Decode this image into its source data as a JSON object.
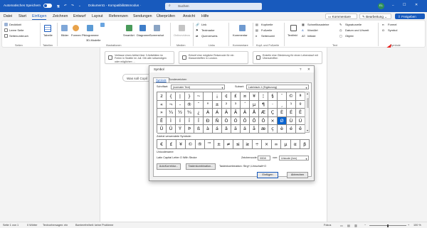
{
  "titlebar": {
    "autosave": "Automatisches Speichern",
    "autosave_state": "",
    "doc_title": "Dokument1  -  Kompatibilitätsmodus  ·",
    "search": "Suchen",
    "avatar": "EL",
    "min": "–",
    "max": "☐",
    "close": "✕"
  },
  "menu": {
    "tabs": [
      "Datei",
      "Start",
      "Einfügen",
      "Zeichnen",
      "Entwurf",
      "Layout",
      "Referenzen",
      "Sendungen",
      "Überprüfen",
      "Ansicht",
      "Hilfe"
    ],
    "comments": "Kommentare",
    "editing": "Bearbeitung",
    "share": "Freigeben"
  },
  "ribbon": {
    "pages": [
      "Deckblatt",
      "Leere Seite",
      "Seitenumbruch"
    ],
    "pages_group": "Seiten",
    "table": "Tabelle",
    "table_group": "Tabellen",
    "illus": [
      "Bilder",
      "Formen",
      "Piktogramme",
      "3D-Modelle",
      "SmartArt",
      "Diagramm",
      "Screenshot"
    ],
    "illus_group": "Illustrationen",
    "media": "Onlinevideos",
    "media_group": "Medien",
    "links": [
      "Link",
      "Textmarke",
      "Querverweis"
    ],
    "links_group": "Links",
    "comment": "Kommentar",
    "comment_group": "Kommentare",
    "header": [
      "Kopfzeile",
      "Fußzeile",
      "Seitenzahl"
    ],
    "header_group": "Kopf- und Fußzeile",
    "textbox": "Textfeld",
    "text_items": [
      "Schnellbausteine",
      "WordArt",
      "Initiale"
    ],
    "text_items2": [
      "Signaturzeile",
      "Datum und Uhrzeit",
      "Objekt"
    ],
    "text_group": "Text",
    "formula": "Formel",
    "symbol": "Symbol",
    "symbols_group": "Symbole"
  },
  "cards": [
    "Verfasse einen Artikel über 3 Aktivitäten im Freien in Seattle im Juli. Gib alle notwendigen oder möglichen …",
    "Entwirf eine mögliche Reiseroute für ein Klassentreffen in London.",
    "Erstelle eine Gliederung für einen Lebenslauf mit Überschriften"
  ],
  "askbar": "Was soll Copil",
  "dialog": {
    "title": "Symbol",
    "help": "?",
    "close": "✕",
    "tab_symbols": "Symbole",
    "tab_special": "Sonderzeichen",
    "font_label": "Schriftart:",
    "font_value": "(normaler Text)",
    "subset_label": "Subset:",
    "subset_value": "Lateinisch-1 (Ergänzung)",
    "grid": [
      [
        "z",
        "{",
        "|",
        "}",
        "~",
        "",
        "¡",
        "¢",
        "£",
        "¤",
        "¥",
        "¦",
        "§",
        "¨",
        "©",
        "ª"
      ],
      [
        "«",
        "¬",
        "-",
        "®",
        "¯",
        "°",
        "±",
        "²",
        "³",
        "´",
        "µ",
        "¶",
        "·",
        "¸",
        "¹",
        "º"
      ],
      [
        "»",
        "¼",
        "½",
        "¾",
        "¿",
        "À",
        "Á",
        "Â",
        "Ã",
        "Ä",
        "Å",
        "Æ",
        "Ç",
        "È",
        "É",
        "Ê"
      ],
      [
        "Ë",
        "Ì",
        "Í",
        "Î",
        "Ï",
        "Ð",
        "Ñ",
        "Ò",
        "Ó",
        "Ô",
        "Õ",
        "Ö",
        "×",
        "Ø",
        "Ù",
        "Ú"
      ],
      [
        "Û",
        "Ü",
        "Ý",
        "Þ",
        "ß",
        "à",
        "á",
        "â",
        "ã",
        "ä",
        "å",
        "æ",
        "ç",
        "è",
        "é",
        "ê"
      ]
    ],
    "selected": "Ø",
    "recent_label": "Zuletzt verwendete Symbole:",
    "recent": [
      "€",
      "£",
      "¥",
      "©",
      "®",
      "™",
      "±",
      "≠",
      "≤",
      "≥",
      "÷",
      "×",
      "∞",
      "µ",
      "α",
      "β"
    ],
    "unicode_label": "Unicodename:",
    "unicode_name": "Latin Capital Letter O With Stroke",
    "code_label": "Zeichencode:",
    "code_value": "00D8",
    "from_label": "von:",
    "from_value": "Unicode (hex)",
    "autocorrect": "AutoKorrektur...",
    "shortcut_btn": "Tastenkombination...",
    "shortcut_text": "Tastenkombination: Strg+/,Umschalt+O",
    "insert": "Einfügen",
    "cancel": "Abbrechen"
  },
  "status": {
    "page": "Seite 1 von 1",
    "words": "0 Wörter",
    "predictions": "Textvorhersagen: ein",
    "accessibility": "Barrierefreiheit: keine Probleme",
    "focus": "Fokus",
    "zoom": "100 %"
  },
  "colors": {
    "titlebar": "#185abd",
    "accent": "#185abd",
    "annotation_arrow": "#e8231f"
  }
}
